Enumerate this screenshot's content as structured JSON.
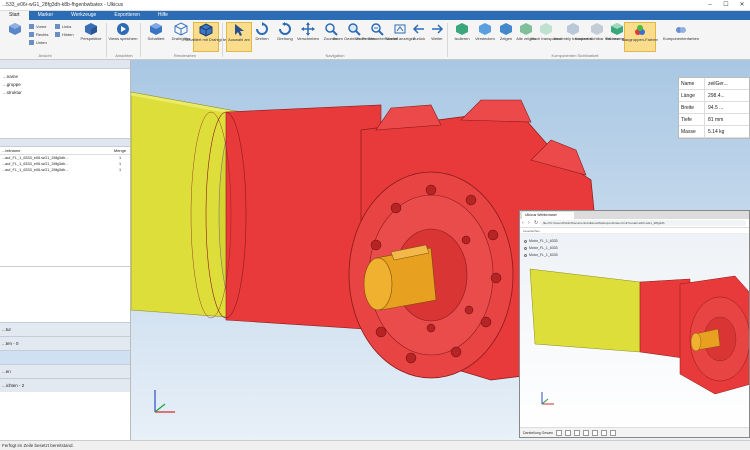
{
  "window": {
    "title": "...533_e06r-wG1_28fg3dh-k8b-fhgenbwbatex - Ulkicus",
    "controls": [
      "–",
      "☐",
      "✕"
    ]
  },
  "tabs": [
    "Start",
    "Marker",
    "Werkzeuge",
    "Exportieren",
    "Hilfe"
  ],
  "ribbon": {
    "groups": [
      "Ansicht",
      "Ansichten",
      "Renderarten",
      "Navigation",
      "Komponenten Sichtbarkeit"
    ],
    "small_items": [
      "Vorne",
      "Rechts",
      "Unten",
      "Links",
      "Hinten"
    ],
    "buttons": {
      "perspective": "Perspektive",
      "views": "Views speichern",
      "shaded": "Schattiert",
      "shaded_light": "Drahtgitter",
      "shaded_edges": "Schattiert mit Drahtgitter",
      "select": "Auswahl am",
      "rotate": "Drehen",
      "spin": "Drehung",
      "pan": "Verschieben",
      "zoom": "Zoomen",
      "zoom_frame": "Zoom Gezieltes Fenster",
      "zoom_all": "Zoom Gesamter Modell",
      "normal": "Normal anzeigen",
      "back": "Zurück",
      "forward": "Weiter",
      "isolate": "Isolieren",
      "hide": "Verstecken",
      "show": "Zeigen",
      "all": "Alle zeigen",
      "transparent": "Mach transparent",
      "assembly": "Assembly transparent",
      "context": "Kontext sichtbar machen",
      "explode": "Teil anzeigen",
      "group_colors": "Baugruppen-Farben",
      "component_colors": "Komponentenfarben"
    }
  },
  "left_panel": {
    "tree": [
      "...name",
      "",
      "...gruppe",
      "...struktur"
    ],
    "table_header": {
      "name": "...teilname",
      "qty": "Menge"
    },
    "rows": [
      {
        "name": "...auf_FL_1_6333_e06-wG1_28fg3dh...",
        "qty": "1"
      },
      {
        "name": "...auf_FL_1_6333_e06-wG1_28fg3dh...",
        "qty": "1"
      },
      {
        "name": "...auf_FL_1_6333_e06-wG1_28fg3dh...",
        "qty": "1"
      }
    ],
    "sections": [
      "...tur",
      "...ten - 0",
      "",
      "...en",
      "...ichten - 2"
    ]
  },
  "info": [
    {
      "key": "Name",
      "value": "zeilGer..."
    },
    {
      "key": "Länge",
      "value": "298.4..."
    },
    {
      "key": "Breite",
      "value": "94.5 ..."
    },
    {
      "key": "Tiefe",
      "value": "81 mm"
    },
    {
      "key": "Masse",
      "value": "5.14 kg"
    }
  ],
  "browser": {
    "tab": "Ulkicus Webbrowser",
    "url": "file:///C:/Users/Public/Documents/Ulkicus/Webexport/index.html?model=e06r-wG1_28fg3dh",
    "bookmarks": "Lesezeichen",
    "tree": [
      "Motor_FL_1_6333",
      "Motor_FL_1_6333",
      "Motor_FL_1_6333"
    ],
    "toolbar_label": "Darstellung Gesam"
  },
  "status": "Ferfügt im Zeile besetzt bereitstand.",
  "colors": {
    "ribbon_tab": "#2b6cb5",
    "selected": "#f9dd8c",
    "motor_red": "#e83a3a",
    "motor_yellow": "#dede3a",
    "shaft_orange": "#e8a020"
  }
}
